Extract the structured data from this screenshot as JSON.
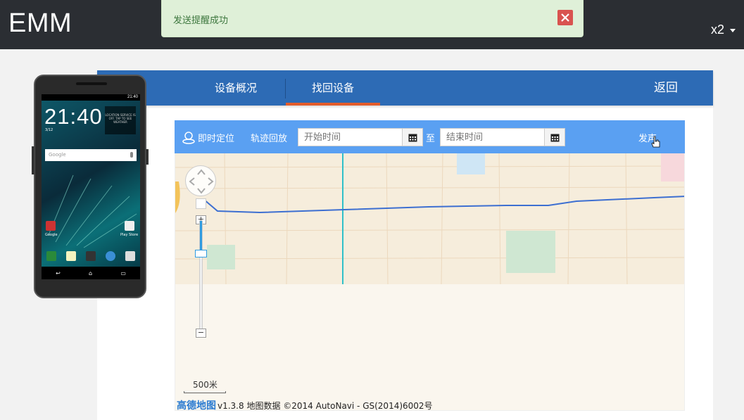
{
  "app": {
    "brand": "EMM",
    "user": "x2"
  },
  "alert": {
    "message": "发送提醒成功"
  },
  "tabs": [
    {
      "label": "设备概况"
    },
    {
      "label": "找回设备"
    }
  ],
  "back_label": "返回",
  "phone": {
    "clock": "21:40",
    "date": "3/12",
    "status_time": "21:40",
    "search_placeholder": "Google",
    "weather_text": "LOCATION SERVICE IS OFF. TAP TO SEE WEATHER",
    "app_labels": [
      "Google",
      "Play Store"
    ]
  },
  "map_toolbar": {
    "locate_label": "即时定位",
    "replay_label": "轨迹回放",
    "start_placeholder": "开始时间",
    "to_label": "至",
    "end_placeholder": "结束时间",
    "send_label": "发声"
  },
  "map": {
    "scale_label": "500米",
    "logo_text": "高德地图",
    "attribution": "v1.3.8 地图数据 ©2014 AutoNavi - GS(2014)6002号",
    "zoom_in": "+",
    "zoom_out": "−"
  },
  "colors": {
    "topbar": "#2b2e33",
    "tabbar": "#2d6bb5",
    "tab_active_underline": "#e35c2b",
    "map_toolbar": "#5aa0f2",
    "alert_bg": "#dff0d8"
  }
}
